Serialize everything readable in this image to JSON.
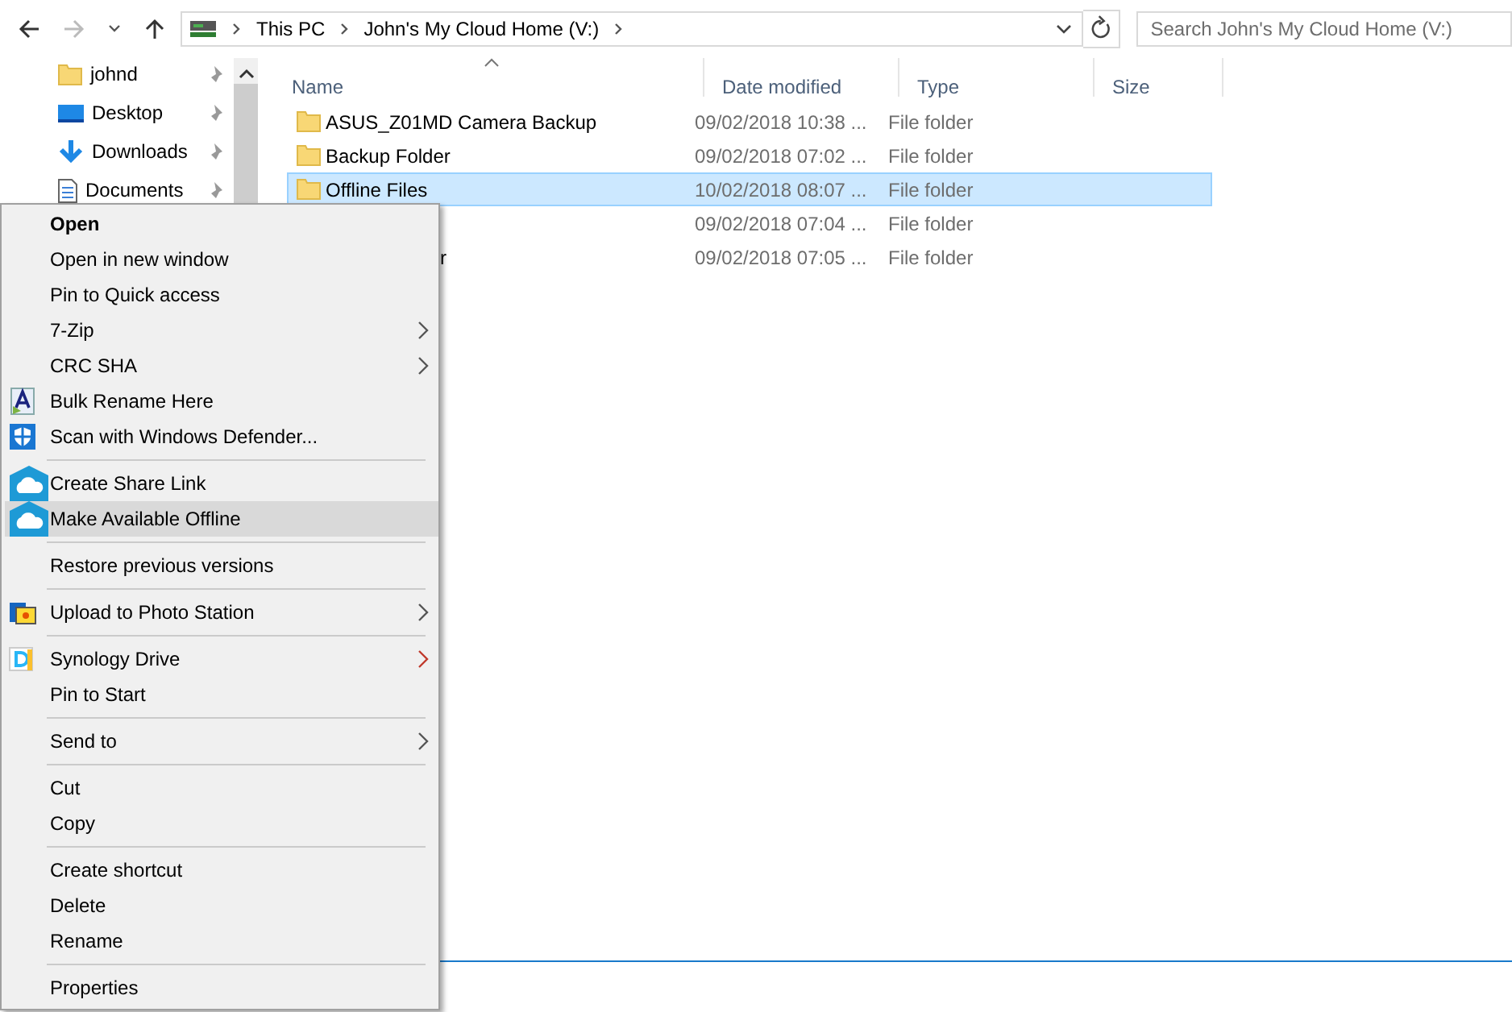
{
  "address_bar": {
    "crumbs": [
      "This PC",
      "John's My Cloud Home (V:)"
    ]
  },
  "search": {
    "placeholder": "Search John's My Cloud Home (V:)"
  },
  "sidebar": {
    "items": [
      {
        "label": "johnd",
        "kind": "folder",
        "pinned": true
      },
      {
        "label": "Desktop",
        "kind": "desktop",
        "pinned": true
      },
      {
        "label": "Downloads",
        "kind": "downloads",
        "pinned": true
      },
      {
        "label": "Documents",
        "kind": "documents",
        "pinned": true
      }
    ]
  },
  "table": {
    "columns": [
      "Name",
      "Date modified",
      "Type",
      "Size"
    ],
    "rows": [
      {
        "name": "ASUS_Z01MD Camera Backup",
        "date": "09/02/2018 10:38 ...",
        "type": "File folder",
        "selected": false,
        "icon": true
      },
      {
        "name": "Backup Folder",
        "date": "09/02/2018 07:02 ...",
        "type": "File folder",
        "selected": false,
        "icon": true
      },
      {
        "name": "Offline Files",
        "date": "10/02/2018 08:07 ...",
        "type": "File folder",
        "selected": true,
        "icon": true
      },
      {
        "date": "09/02/2018 07:04 ...",
        "type": "File folder",
        "selected": false,
        "icon": false
      },
      {
        "name": "r",
        "date": "09/02/2018 07:05 ...",
        "type": "File folder",
        "selected": false,
        "icon": false
      }
    ]
  },
  "context_menu": {
    "items": [
      {
        "kind": "item",
        "label": "Open",
        "default": true,
        "submenu": false,
        "selected": false
      },
      {
        "kind": "item",
        "label": "Open in new window",
        "default": false,
        "submenu": false,
        "selected": false
      },
      {
        "kind": "item",
        "label": "Pin to Quick access",
        "default": false,
        "submenu": false,
        "selected": false
      },
      {
        "kind": "item",
        "label": "7-Zip",
        "default": false,
        "submenu": true,
        "selected": false
      },
      {
        "kind": "item",
        "label": "CRC SHA",
        "default": false,
        "submenu": true,
        "selected": false
      },
      {
        "kind": "rename",
        "label": "Bulk Rename Here",
        "default": false,
        "submenu": false,
        "selected": false
      },
      {
        "kind": "shield",
        "label": "Scan with Windows Defender...",
        "default": false,
        "submenu": false,
        "selected": false
      },
      {
        "kind": "separator"
      },
      {
        "kind": "cloud",
        "label": "Create Share Link",
        "default": false,
        "submenu": false,
        "selected": false
      },
      {
        "kind": "cloud",
        "label": "Make Available Offline",
        "default": false,
        "submenu": false,
        "selected": true
      },
      {
        "kind": "separator"
      },
      {
        "kind": "item",
        "label": "Restore previous versions",
        "default": false,
        "submenu": false,
        "selected": false
      },
      {
        "kind": "separator"
      },
      {
        "kind": "photo",
        "label": "Upload to Photo Station",
        "default": false,
        "submenu": true,
        "selected": false
      },
      {
        "kind": "separator"
      },
      {
        "kind": "drive",
        "label": "Synology Drive",
        "default": false,
        "submenu": true,
        "selected": false
      },
      {
        "kind": "item",
        "label": "Pin to Start",
        "default": false,
        "submenu": false,
        "selected": false
      },
      {
        "kind": "separator"
      },
      {
        "kind": "item",
        "label": "Send to",
        "default": false,
        "submenu": true,
        "selected": false
      },
      {
        "kind": "separator"
      },
      {
        "kind": "item",
        "label": "Cut",
        "default": false,
        "submenu": false,
        "selected": false
      },
      {
        "kind": "item",
        "label": "Copy",
        "default": false,
        "submenu": false,
        "selected": false
      },
      {
        "kind": "separator"
      },
      {
        "kind": "item",
        "label": "Create shortcut",
        "default": false,
        "submenu": false,
        "selected": false
      },
      {
        "kind": "item",
        "label": "Delete",
        "default": false,
        "submenu": false,
        "selected": false
      },
      {
        "kind": "item",
        "label": "Rename",
        "default": false,
        "submenu": false,
        "selected": false
      },
      {
        "kind": "separator"
      },
      {
        "kind": "item",
        "label": "Properties",
        "default": false,
        "submenu": false,
        "selected": false
      }
    ]
  }
}
